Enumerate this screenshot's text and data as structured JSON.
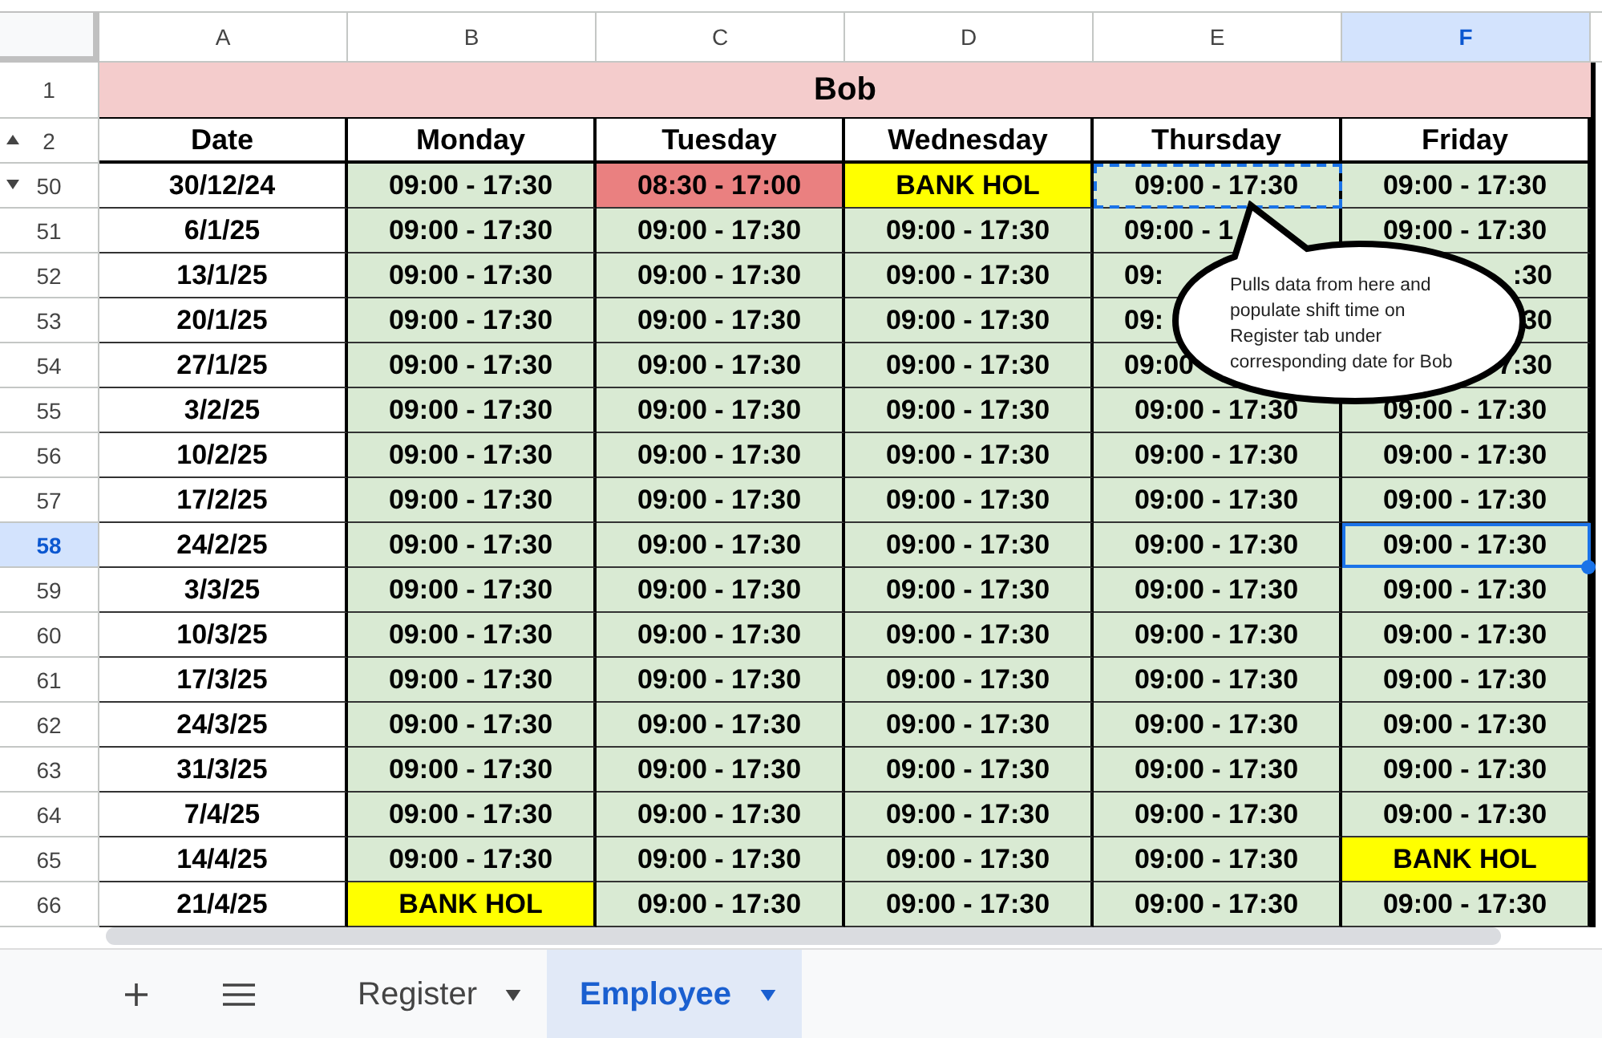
{
  "sheet": {
    "columns": [
      {
        "label": "A",
        "selected": false
      },
      {
        "label": "B",
        "selected": false
      },
      {
        "label": "C",
        "selected": false
      },
      {
        "label": "D",
        "selected": false
      },
      {
        "label": "E",
        "selected": false
      },
      {
        "label": "F",
        "selected": true
      }
    ],
    "title_row": {
      "row": "1",
      "text": "Bob"
    },
    "header_row": {
      "row": "2",
      "labels": [
        "Date",
        "Monday",
        "Tuesday",
        "Wednesday",
        "Thursday",
        "Friday"
      ]
    },
    "rows": [
      {
        "row": "50",
        "selected": false,
        "cells": [
          {
            "text": "30/12/24",
            "kind": "date",
            "selected": false,
            "copied": false
          },
          {
            "text": "09:00 - 17:30",
            "kind": "shift",
            "selected": false,
            "copied": false
          },
          {
            "text": "08:30 - 17:00",
            "kind": "changed",
            "selected": false,
            "copied": false
          },
          {
            "text": "BANK HOL",
            "kind": "holiday",
            "selected": false,
            "copied": false
          },
          {
            "text": "09:00 - 17:30",
            "kind": "shift",
            "selected": false,
            "copied": true
          },
          {
            "text": "09:00 - 17:30",
            "kind": "shift",
            "selected": false,
            "copied": false
          }
        ]
      },
      {
        "row": "51",
        "selected": false,
        "cells": [
          {
            "text": "6/1/25",
            "kind": "date",
            "selected": false,
            "copied": false
          },
          {
            "text": "09:00 - 17:30",
            "kind": "shift",
            "selected": false,
            "copied": false
          },
          {
            "text": "09:00 - 17:30",
            "kind": "shift",
            "selected": false,
            "copied": false
          },
          {
            "text": "09:00 - 17:30",
            "kind": "shift",
            "selected": false,
            "copied": false
          },
          {
            "text": "09:00 - 1",
            "kind": "shift",
            "selected": false,
            "copied": false,
            "cut_end": true
          },
          {
            "text": "09:00 - 17:30",
            "kind": "shift",
            "selected": false,
            "copied": false
          }
        ]
      },
      {
        "row": "52",
        "selected": false,
        "cells": [
          {
            "text": "13/1/25",
            "kind": "date",
            "selected": false,
            "copied": false
          },
          {
            "text": "09:00 - 17:30",
            "kind": "shift",
            "selected": false,
            "copied": false
          },
          {
            "text": "09:00 - 17:30",
            "kind": "shift",
            "selected": false,
            "copied": false
          },
          {
            "text": "09:00 - 17:30",
            "kind": "shift",
            "selected": false,
            "copied": false
          },
          {
            "text": "09:",
            "kind": "shift",
            "selected": false,
            "copied": false,
            "cut_end": true
          },
          {
            "text": ":30",
            "kind": "shift",
            "selected": false,
            "copied": false,
            "cut_start": true
          }
        ]
      },
      {
        "row": "53",
        "selected": false,
        "cells": [
          {
            "text": "20/1/25",
            "kind": "date",
            "selected": false,
            "copied": false
          },
          {
            "text": "09:00 - 17:30",
            "kind": "shift",
            "selected": false,
            "copied": false
          },
          {
            "text": "09:00 - 17:30",
            "kind": "shift",
            "selected": false,
            "copied": false
          },
          {
            "text": "09:00 - 17:30",
            "kind": "shift",
            "selected": false,
            "copied": false
          },
          {
            "text": "09:",
            "kind": "shift",
            "selected": false,
            "copied": false,
            "cut_end": true
          },
          {
            "text": "30",
            "kind": "shift",
            "selected": false,
            "copied": false,
            "cut_start": true
          }
        ]
      },
      {
        "row": "54",
        "selected": false,
        "cells": [
          {
            "text": "27/1/25",
            "kind": "date",
            "selected": false,
            "copied": false
          },
          {
            "text": "09:00 - 17:30",
            "kind": "shift",
            "selected": false,
            "copied": false
          },
          {
            "text": "09:00 - 17:30",
            "kind": "shift",
            "selected": false,
            "copied": false
          },
          {
            "text": "09:00 - 17:30",
            "kind": "shift",
            "selected": false,
            "copied": false
          },
          {
            "text": "09:00",
            "kind": "shift",
            "selected": false,
            "copied": false,
            "cut_end": true
          },
          {
            "text": "7:30",
            "kind": "shift",
            "selected": false,
            "copied": false,
            "cut_start": true
          }
        ]
      },
      {
        "row": "55",
        "selected": false,
        "cells": [
          {
            "text": "3/2/25",
            "kind": "date",
            "selected": false,
            "copied": false
          },
          {
            "text": "09:00 - 17:30",
            "kind": "shift",
            "selected": false,
            "copied": false
          },
          {
            "text": "09:00 - 17:30",
            "kind": "shift",
            "selected": false,
            "copied": false
          },
          {
            "text": "09:00 - 17:30",
            "kind": "shift",
            "selected": false,
            "copied": false
          },
          {
            "text": "09:00 - 17:30",
            "kind": "shift",
            "selected": false,
            "copied": false
          },
          {
            "text": "09:00 - 17:30",
            "kind": "shift",
            "selected": false,
            "copied": false
          }
        ]
      },
      {
        "row": "56",
        "selected": false,
        "cells": [
          {
            "text": "10/2/25",
            "kind": "date",
            "selected": false,
            "copied": false
          },
          {
            "text": "09:00 - 17:30",
            "kind": "shift",
            "selected": false,
            "copied": false
          },
          {
            "text": "09:00 - 17:30",
            "kind": "shift",
            "selected": false,
            "copied": false
          },
          {
            "text": "09:00 - 17:30",
            "kind": "shift",
            "selected": false,
            "copied": false
          },
          {
            "text": "09:00 - 17:30",
            "kind": "shift",
            "selected": false,
            "copied": false
          },
          {
            "text": "09:00 - 17:30",
            "kind": "shift",
            "selected": false,
            "copied": false
          }
        ]
      },
      {
        "row": "57",
        "selected": false,
        "cells": [
          {
            "text": "17/2/25",
            "kind": "date",
            "selected": false,
            "copied": false
          },
          {
            "text": "09:00 - 17:30",
            "kind": "shift",
            "selected": false,
            "copied": false
          },
          {
            "text": "09:00 - 17:30",
            "kind": "shift",
            "selected": false,
            "copied": false
          },
          {
            "text": "09:00 - 17:30",
            "kind": "shift",
            "selected": false,
            "copied": false
          },
          {
            "text": "09:00 - 17:30",
            "kind": "shift",
            "selected": false,
            "copied": false
          },
          {
            "text": "09:00 - 17:30",
            "kind": "shift",
            "selected": false,
            "copied": false
          }
        ]
      },
      {
        "row": "58",
        "selected": true,
        "cells": [
          {
            "text": "24/2/25",
            "kind": "date",
            "selected": false,
            "copied": false
          },
          {
            "text": "09:00 - 17:30",
            "kind": "shift",
            "selected": false,
            "copied": false
          },
          {
            "text": "09:00 - 17:30",
            "kind": "shift",
            "selected": false,
            "copied": false
          },
          {
            "text": "09:00 - 17:30",
            "kind": "shift",
            "selected": false,
            "copied": false
          },
          {
            "text": "09:00 - 17:30",
            "kind": "shift",
            "selected": false,
            "copied": false
          },
          {
            "text": "09:00 - 17:30",
            "kind": "shift",
            "selected": true,
            "copied": false
          }
        ]
      },
      {
        "row": "59",
        "selected": false,
        "cells": [
          {
            "text": "3/3/25",
            "kind": "date",
            "selected": false,
            "copied": false
          },
          {
            "text": "09:00 - 17:30",
            "kind": "shift",
            "selected": false,
            "copied": false
          },
          {
            "text": "09:00 - 17:30",
            "kind": "shift",
            "selected": false,
            "copied": false
          },
          {
            "text": "09:00 - 17:30",
            "kind": "shift",
            "selected": false,
            "copied": false
          },
          {
            "text": "09:00 - 17:30",
            "kind": "shift",
            "selected": false,
            "copied": false
          },
          {
            "text": "09:00 - 17:30",
            "kind": "shift",
            "selected": false,
            "copied": false
          }
        ]
      },
      {
        "row": "60",
        "selected": false,
        "cells": [
          {
            "text": "10/3/25",
            "kind": "date",
            "selected": false,
            "copied": false
          },
          {
            "text": "09:00 - 17:30",
            "kind": "shift",
            "selected": false,
            "copied": false
          },
          {
            "text": "09:00 - 17:30",
            "kind": "shift",
            "selected": false,
            "copied": false
          },
          {
            "text": "09:00 - 17:30",
            "kind": "shift",
            "selected": false,
            "copied": false
          },
          {
            "text": "09:00 - 17:30",
            "kind": "shift",
            "selected": false,
            "copied": false
          },
          {
            "text": "09:00 - 17:30",
            "kind": "shift",
            "selected": false,
            "copied": false
          }
        ]
      },
      {
        "row": "61",
        "selected": false,
        "cells": [
          {
            "text": "17/3/25",
            "kind": "date",
            "selected": false,
            "copied": false
          },
          {
            "text": "09:00 - 17:30",
            "kind": "shift",
            "selected": false,
            "copied": false
          },
          {
            "text": "09:00 - 17:30",
            "kind": "shift",
            "selected": false,
            "copied": false
          },
          {
            "text": "09:00 - 17:30",
            "kind": "shift",
            "selected": false,
            "copied": false
          },
          {
            "text": "09:00 - 17:30",
            "kind": "shift",
            "selected": false,
            "copied": false
          },
          {
            "text": "09:00 - 17:30",
            "kind": "shift",
            "selected": false,
            "copied": false
          }
        ]
      },
      {
        "row": "62",
        "selected": false,
        "cells": [
          {
            "text": "24/3/25",
            "kind": "date",
            "selected": false,
            "copied": false
          },
          {
            "text": "09:00 - 17:30",
            "kind": "shift",
            "selected": false,
            "copied": false
          },
          {
            "text": "09:00 - 17:30",
            "kind": "shift",
            "selected": false,
            "copied": false
          },
          {
            "text": "09:00 - 17:30",
            "kind": "shift",
            "selected": false,
            "copied": false
          },
          {
            "text": "09:00 - 17:30",
            "kind": "shift",
            "selected": false,
            "copied": false
          },
          {
            "text": "09:00 - 17:30",
            "kind": "shift",
            "selected": false,
            "copied": false
          }
        ]
      },
      {
        "row": "63",
        "selected": false,
        "cells": [
          {
            "text": "31/3/25",
            "kind": "date",
            "selected": false,
            "copied": false
          },
          {
            "text": "09:00 - 17:30",
            "kind": "shift",
            "selected": false,
            "copied": false
          },
          {
            "text": "09:00 - 17:30",
            "kind": "shift",
            "selected": false,
            "copied": false
          },
          {
            "text": "09:00 - 17:30",
            "kind": "shift",
            "selected": false,
            "copied": false
          },
          {
            "text": "09:00 - 17:30",
            "kind": "shift",
            "selected": false,
            "copied": false
          },
          {
            "text": "09:00 - 17:30",
            "kind": "shift",
            "selected": false,
            "copied": false
          }
        ]
      },
      {
        "row": "64",
        "selected": false,
        "cells": [
          {
            "text": "7/4/25",
            "kind": "date",
            "selected": false,
            "copied": false
          },
          {
            "text": "09:00 - 17:30",
            "kind": "shift",
            "selected": false,
            "copied": false
          },
          {
            "text": "09:00 - 17:30",
            "kind": "shift",
            "selected": false,
            "copied": false
          },
          {
            "text": "09:00 - 17:30",
            "kind": "shift",
            "selected": false,
            "copied": false
          },
          {
            "text": "09:00 - 17:30",
            "kind": "shift",
            "selected": false,
            "copied": false
          },
          {
            "text": "09:00 - 17:30",
            "kind": "shift",
            "selected": false,
            "copied": false
          }
        ]
      },
      {
        "row": "65",
        "selected": false,
        "cells": [
          {
            "text": "14/4/25",
            "kind": "date",
            "selected": false,
            "copied": false
          },
          {
            "text": "09:00 - 17:30",
            "kind": "shift",
            "selected": false,
            "copied": false
          },
          {
            "text": "09:00 - 17:30",
            "kind": "shift",
            "selected": false,
            "copied": false
          },
          {
            "text": "09:00 - 17:30",
            "kind": "shift",
            "selected": false,
            "copied": false
          },
          {
            "text": "09:00 - 17:30",
            "kind": "shift",
            "selected": false,
            "copied": false
          },
          {
            "text": "BANK HOL",
            "kind": "holiday",
            "selected": false,
            "copied": false
          }
        ]
      },
      {
        "row": "66",
        "selected": false,
        "cells": [
          {
            "text": "21/4/25",
            "kind": "date",
            "selected": false,
            "copied": false
          },
          {
            "text": "BANK HOL",
            "kind": "holiday",
            "selected": false,
            "copied": false
          },
          {
            "text": "09:00 - 17:30",
            "kind": "shift",
            "selected": false,
            "copied": false
          },
          {
            "text": "09:00 - 17:30",
            "kind": "shift",
            "selected": false,
            "copied": false
          },
          {
            "text": "09:00 - 17:30",
            "kind": "shift",
            "selected": false,
            "copied": false
          },
          {
            "text": "09:00 - 17:30",
            "kind": "shift",
            "selected": false,
            "copied": false
          }
        ]
      }
    ]
  },
  "callout": {
    "text": "Pulls data from here and populate shift time on Register tab under corresponding date for Bob"
  },
  "tabs": [
    {
      "label": "Register",
      "selected": false
    },
    {
      "label": "Employee",
      "selected": true
    }
  ]
}
